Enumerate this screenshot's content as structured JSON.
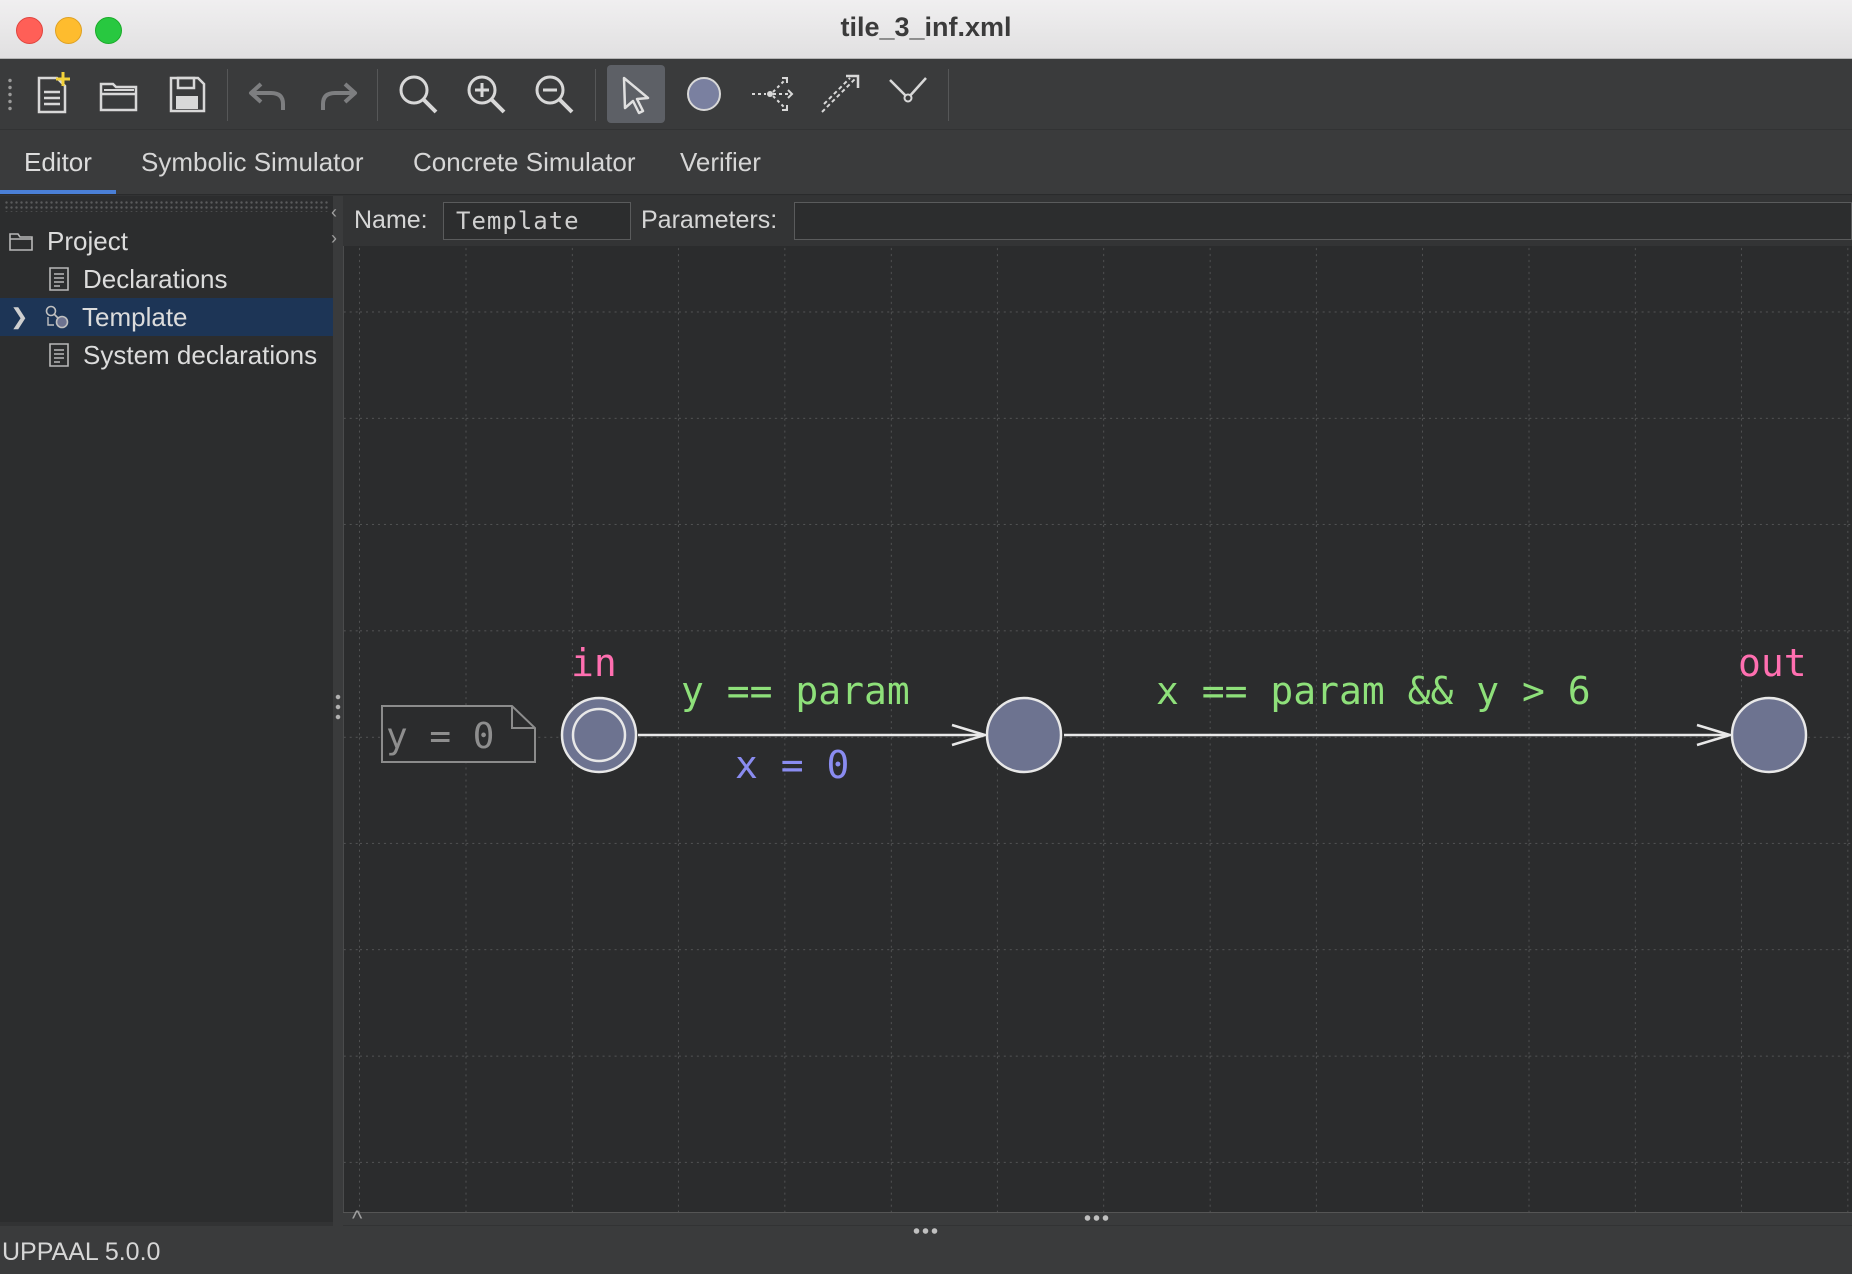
{
  "window": {
    "title": "tile_3_inf.xml"
  },
  "toolbar": {
    "buttons": [
      "new-document",
      "open-document",
      "save-document",
      "undo",
      "redo",
      "zoom-fit",
      "zoom-in",
      "zoom-out",
      "select-tool",
      "add-location",
      "add-branch-point",
      "add-edge",
      "add-nail"
    ],
    "selected": "select-tool"
  },
  "tabs": [
    {
      "label": "Editor",
      "active": true
    },
    {
      "label": "Symbolic Simulator",
      "active": false
    },
    {
      "label": "Concrete Simulator",
      "active": false
    },
    {
      "label": "Verifier",
      "active": false
    }
  ],
  "tree": {
    "root": "Project",
    "items": [
      {
        "label": "Declarations",
        "icon": "document-icon"
      },
      {
        "label": "Template",
        "icon": "template-icon",
        "selected": true,
        "expandable": true
      },
      {
        "label": "System declarations",
        "icon": "document-icon"
      }
    ]
  },
  "editor": {
    "name_label": "Name:",
    "name_value": "Template",
    "parameters_label": "Parameters:",
    "parameters_value": ""
  },
  "automaton": {
    "note": "y = 0",
    "locations": [
      {
        "id": "l0",
        "name": "in",
        "initial": true
      },
      {
        "id": "l1",
        "name": ""
      },
      {
        "id": "l2",
        "name": "out"
      }
    ],
    "edges": [
      {
        "from": "l0",
        "to": "l1",
        "guard": "y == param",
        "update": "x = 0"
      },
      {
        "from": "l1",
        "to": "l2",
        "guard": "x == param && y > 6",
        "update": ""
      }
    ],
    "colors": {
      "guard": "#8ee07a",
      "update": "#8a8cf0",
      "name": "#ff6fb0",
      "location": "#6d7390",
      "edge": "#e8e8e8"
    }
  },
  "status": {
    "text": "UPPAAL 5.0.0"
  }
}
